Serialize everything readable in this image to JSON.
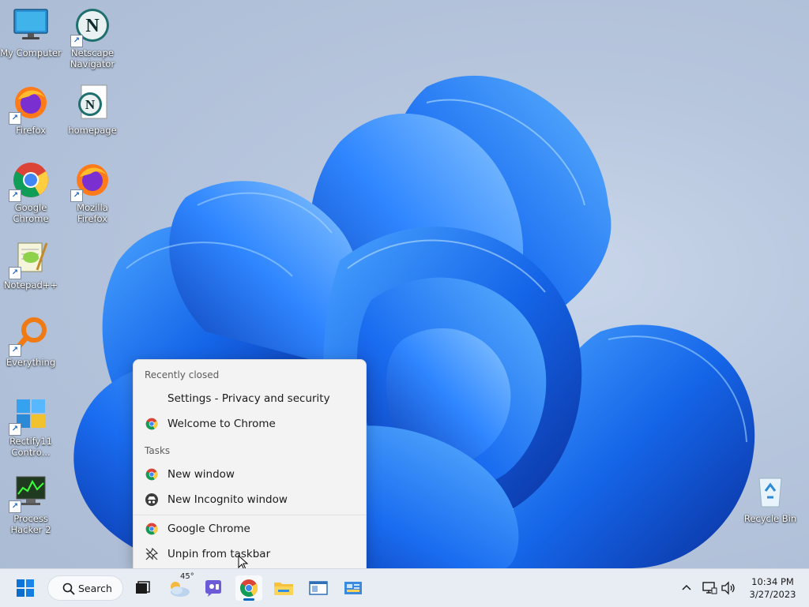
{
  "desktop_icons": [
    {
      "name": "my-computer",
      "label": "My Computer",
      "icon": "monitor-icon"
    },
    {
      "name": "netscape-navigator",
      "label_lines": [
        "Netscape",
        "Navigator"
      ],
      "icon": "netscape-icon"
    },
    {
      "name": "firefox",
      "label": "Firefox",
      "icon": "firefox-icon"
    },
    {
      "name": "homepage",
      "label": "homepage",
      "icon": "netscape-document-icon"
    },
    {
      "name": "google-chrome",
      "label_lines": [
        "Google",
        "Chrome"
      ],
      "icon": "chrome-icon"
    },
    {
      "name": "mozilla-firefox",
      "label_lines": [
        "Mozilla",
        "Firefox"
      ],
      "icon": "firefox-icon"
    },
    {
      "name": "notepad-plus-plus",
      "label": "Notepad++",
      "icon": "notepad-plus-plus-icon"
    },
    {
      "name": "everything",
      "label": "Everything",
      "icon": "magnifier-icon"
    },
    {
      "name": "rectify11",
      "label_lines": [
        "Rectify11",
        "Contro..."
      ],
      "icon": "rectify11-icon"
    },
    {
      "name": "process-hacker",
      "label_lines": [
        "Process",
        "Hacker 2"
      ],
      "icon": "process-hacker-icon"
    },
    {
      "name": "recycle-bin",
      "label": "Recycle Bin",
      "icon": "recycle-bin-icon"
    }
  ],
  "jump_list": {
    "recently_closed_header": "Recently closed",
    "recently_closed": [
      {
        "label": "Settings - Privacy and security",
        "icon": "none"
      },
      {
        "label": "Welcome to Chrome",
        "icon": "chrome-icon"
      }
    ],
    "tasks_header": "Tasks",
    "tasks": [
      {
        "label": "New window",
        "icon": "chrome-icon"
      },
      {
        "label": "New Incognito window",
        "icon": "incognito-icon"
      }
    ],
    "app": {
      "label": "Google Chrome",
      "icon": "chrome-icon"
    },
    "unpin": {
      "label": "Unpin from taskbar",
      "icon": "unpin-icon"
    }
  },
  "taskbar": {
    "search_label": "Search",
    "weather_temp": "45°",
    "apps": [
      "start-icon",
      "search-icon",
      "task-view-icon",
      "weather-icon",
      "chat-icon",
      "chrome-icon",
      "file-explorer-icon",
      "app-window-icon",
      "control-panel-icon"
    ],
    "active_app": "chrome-icon"
  },
  "tray": {
    "time": "10:34 PM",
    "date": "3/27/2023",
    "icons": [
      "chevron-up-icon",
      "network-icon",
      "volume-icon"
    ]
  },
  "colors": {
    "accent": "#0067c0",
    "wallpaper_blue": "#1565e8",
    "taskbar_bg": "#e8edf4",
    "menu_bg": "#f3f3f3"
  }
}
